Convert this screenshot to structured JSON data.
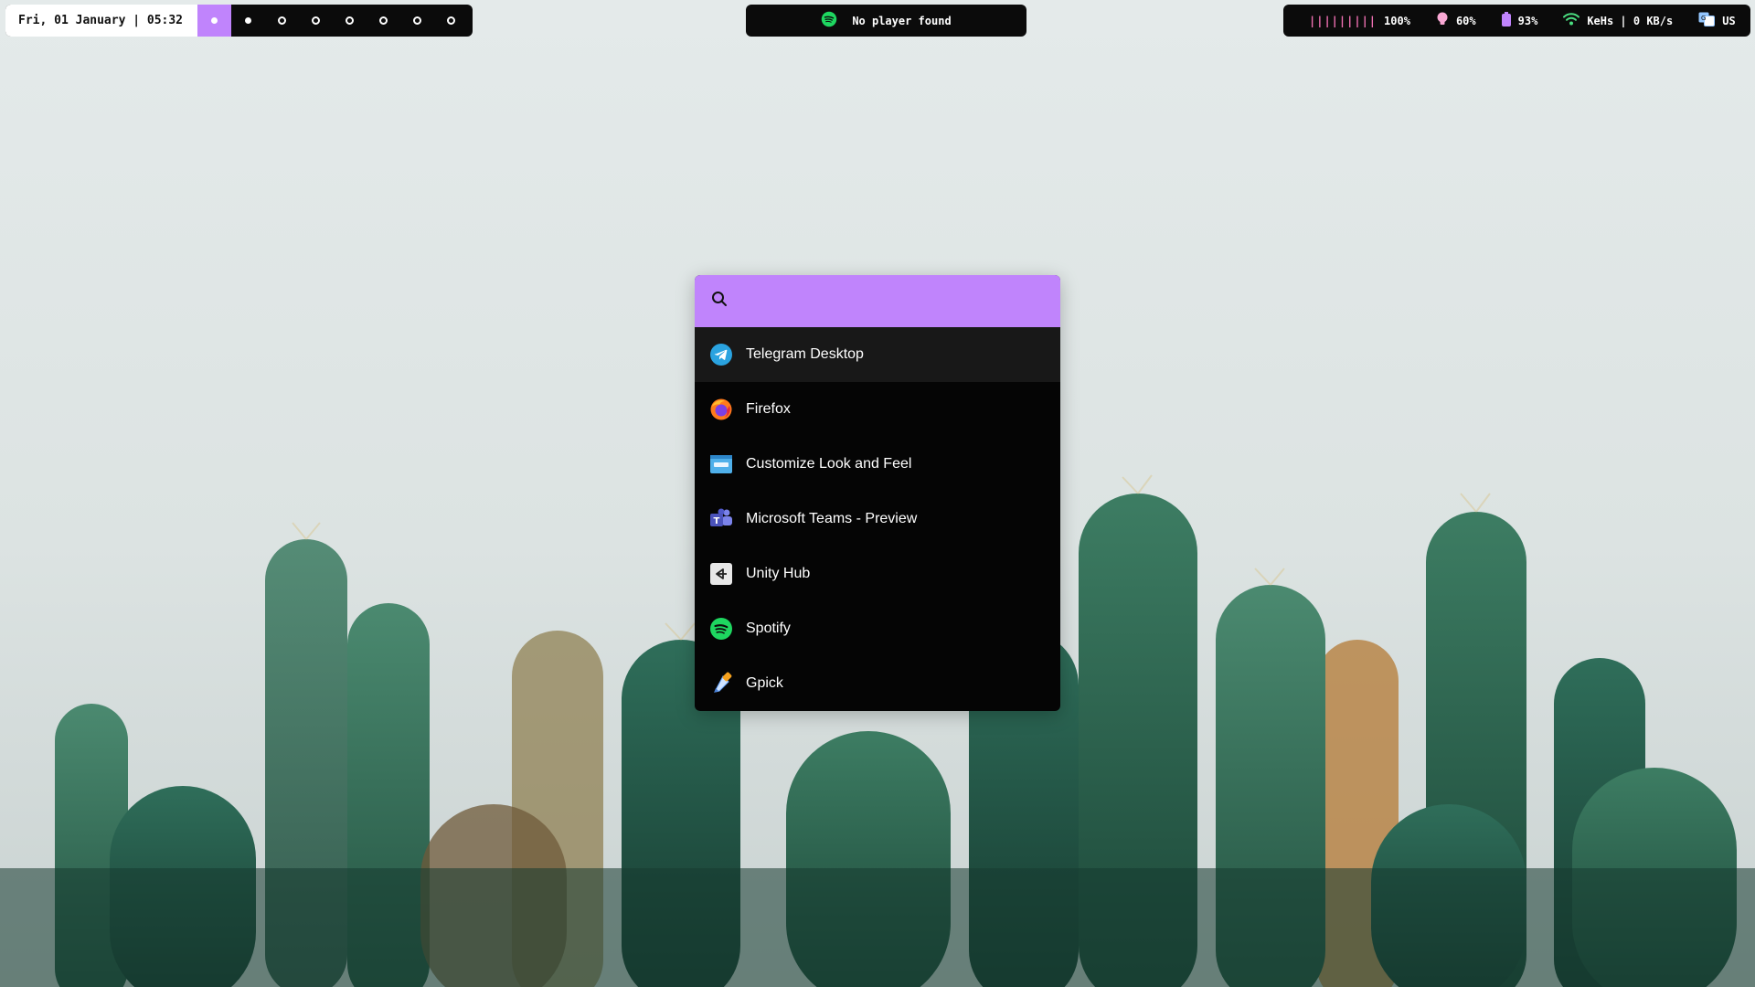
{
  "topbar": {
    "clock": "Fri, 01 January | 05:32",
    "workspaces": [
      {
        "state": "active"
      },
      {
        "state": "occupied"
      },
      {
        "state": "empty"
      },
      {
        "state": "empty"
      },
      {
        "state": "empty"
      },
      {
        "state": "empty"
      },
      {
        "state": "empty"
      },
      {
        "state": "empty"
      }
    ],
    "player": {
      "icon": "spotify-icon",
      "text": "No player found"
    },
    "status": {
      "volume_bars": "|||||||||",
      "volume": "100%",
      "brightness_icon": "lightbulb-icon",
      "brightness": "60%",
      "battery_icon": "battery-icon",
      "battery": "93%",
      "wifi_icon": "wifi-icon",
      "network": "KeHs | 0 KB/s",
      "keyboard_icon": "language-icon",
      "keyboard_layout": "US"
    }
  },
  "launcher": {
    "search_value": "",
    "results": [
      {
        "label": "Telegram Desktop",
        "icon": "telegram-icon",
        "selected": true
      },
      {
        "label": "Firefox",
        "icon": "firefox-icon",
        "selected": false
      },
      {
        "label": "Customize Look and Feel",
        "icon": "appearance-settings-icon",
        "selected": false
      },
      {
        "label": "Microsoft Teams - Preview",
        "icon": "teams-icon",
        "selected": false
      },
      {
        "label": "Unity Hub",
        "icon": "unity-icon",
        "selected": false
      },
      {
        "label": "Spotify",
        "icon": "spotify-icon",
        "selected": false
      },
      {
        "label": "Gpick",
        "icon": "color-picker-icon",
        "selected": false
      }
    ]
  },
  "colors": {
    "accent": "#c084fc",
    "bar_bg": "#0b0b0b",
    "volume": "#f472b6",
    "brightness": "#f9a8d4",
    "battery": "#c084fc",
    "wifi": "#4ade80",
    "spotify": "#1ed760"
  }
}
